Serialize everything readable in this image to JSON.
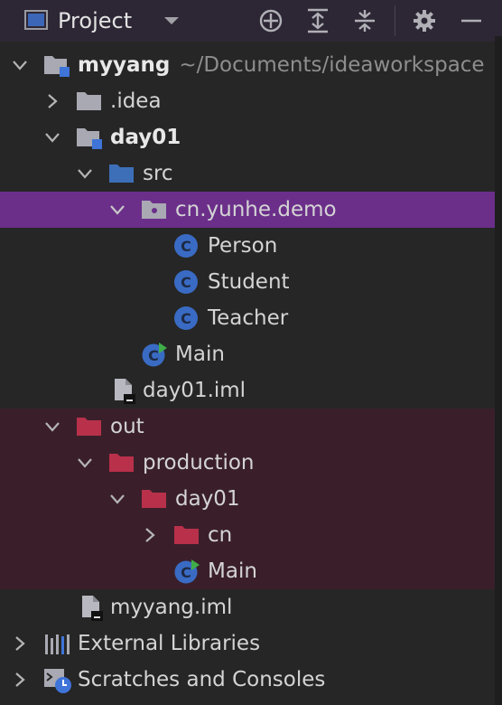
{
  "header": {
    "title": "Project",
    "icons": [
      "project-view-icon",
      "chevron-down-icon",
      "crosshair-icon",
      "expand-all-icon",
      "collapse-all-icon",
      "gear-icon",
      "minimize-icon"
    ]
  },
  "tree": {
    "root": {
      "name": "myyang",
      "path": "~/Documents/ideaworkspace"
    },
    "idea": "idea",
    "day01": "day01",
    "src": "src",
    "package": "cn.yunhe.demo",
    "person": "Person",
    "student": "Student",
    "teacher": "Teacher",
    "main": "Main",
    "day01_iml": "day01.iml",
    "out": "out",
    "production": "production",
    "out_day01": "day01",
    "cn": "cn",
    "out_main": "Main",
    "myyang_iml": "myyang.iml",
    "external_libraries": "External Libraries",
    "scratches": "Scratches and Consoles"
  },
  "colors": {
    "selected_row": "#6b2f8a",
    "excluded_row": "#3a1f2a",
    "folder_gray": "#a9a9b3",
    "folder_blue": "#3d6fb8",
    "folder_red": "#b8304a",
    "class_icon": "#3a6bc4",
    "run_green": "#3fae4a"
  }
}
